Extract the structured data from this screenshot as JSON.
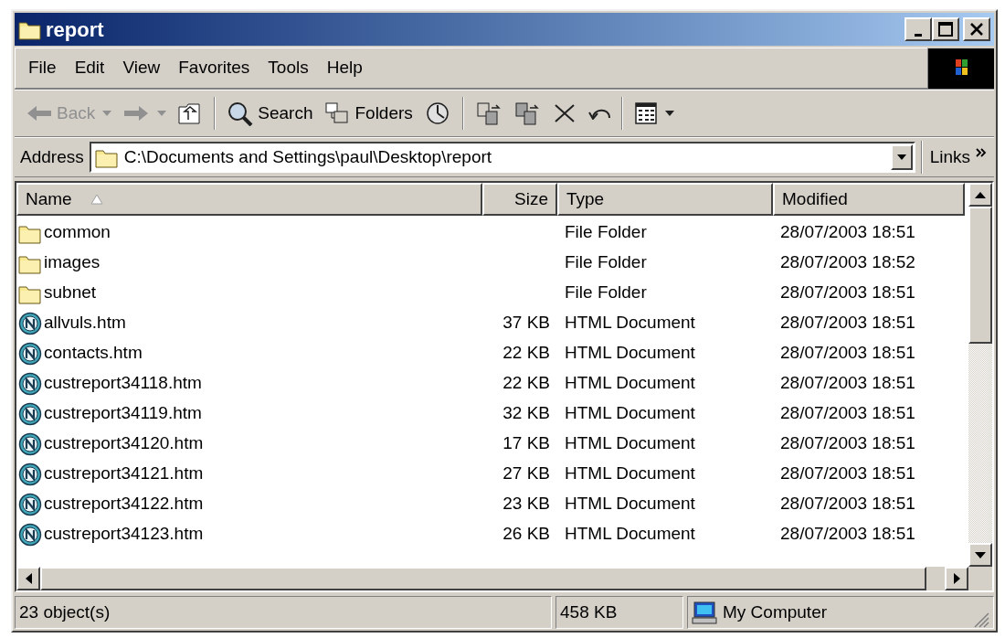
{
  "window": {
    "title": "report"
  },
  "menu": [
    "File",
    "Edit",
    "View",
    "Favorites",
    "Tools",
    "Help"
  ],
  "toolbar": [
    {
      "kind": "back",
      "label": "Back",
      "disabled": true
    },
    {
      "kind": "forward",
      "disabled": true
    },
    {
      "kind": "up",
      "disabled": false
    },
    {
      "kind": "separator"
    },
    {
      "kind": "search",
      "label": "Search",
      "disabled": false
    },
    {
      "kind": "folders",
      "label": "Folders",
      "disabled": false
    },
    {
      "kind": "history",
      "disabled": false
    },
    {
      "kind": "separator"
    },
    {
      "kind": "move",
      "disabled": false
    },
    {
      "kind": "copy",
      "disabled": false
    },
    {
      "kind": "delete",
      "disabled": false
    },
    {
      "kind": "undo",
      "disabled": false
    },
    {
      "kind": "separator"
    },
    {
      "kind": "views",
      "disabled": false
    }
  ],
  "address": {
    "label": "Address",
    "value": "C:\\Documents and Settings\\paul\\Desktop\\report",
    "links": "Links"
  },
  "table": {
    "columns": [
      {
        "label": "Name",
        "sorted": true
      },
      {
        "label": "Size",
        "sorted": false
      },
      {
        "label": "Type",
        "sorted": false
      },
      {
        "label": "Modified",
        "sorted": false
      }
    ],
    "rows": [
      {
        "kind": "folder",
        "name": "common",
        "size": "",
        "type": "File Folder",
        "modified": "28/07/2003 18:51"
      },
      {
        "kind": "folder",
        "name": "images",
        "size": "",
        "type": "File Folder",
        "modified": "28/07/2003 18:52"
      },
      {
        "kind": "folder",
        "name": "subnet",
        "size": "",
        "type": "File Folder",
        "modified": "28/07/2003 18:51"
      },
      {
        "kind": "html",
        "name": "allvuls.htm",
        "size": "37 KB",
        "type": "HTML Document",
        "modified": "28/07/2003 18:51"
      },
      {
        "kind": "html",
        "name": "contacts.htm",
        "size": "22 KB",
        "type": "HTML Document",
        "modified": "28/07/2003 18:51"
      },
      {
        "kind": "html",
        "name": "custreport34118.htm",
        "size": "22 KB",
        "type": "HTML Document",
        "modified": "28/07/2003 18:51"
      },
      {
        "kind": "html",
        "name": "custreport34119.htm",
        "size": "32 KB",
        "type": "HTML Document",
        "modified": "28/07/2003 18:51"
      },
      {
        "kind": "html",
        "name": "custreport34120.htm",
        "size": "17 KB",
        "type": "HTML Document",
        "modified": "28/07/2003 18:51"
      },
      {
        "kind": "html",
        "name": "custreport34121.htm",
        "size": "27 KB",
        "type": "HTML Document",
        "modified": "28/07/2003 18:51"
      },
      {
        "kind": "html",
        "name": "custreport34122.htm",
        "size": "23 KB",
        "type": "HTML Document",
        "modified": "28/07/2003 18:51"
      },
      {
        "kind": "html",
        "name": "custreport34123.htm",
        "size": "26 KB",
        "type": "HTML Document",
        "modified": "28/07/2003 18:51"
      }
    ]
  },
  "status_bar": {
    "objects": "23 object(s)",
    "size": "458 KB",
    "zone": "My Computer"
  }
}
